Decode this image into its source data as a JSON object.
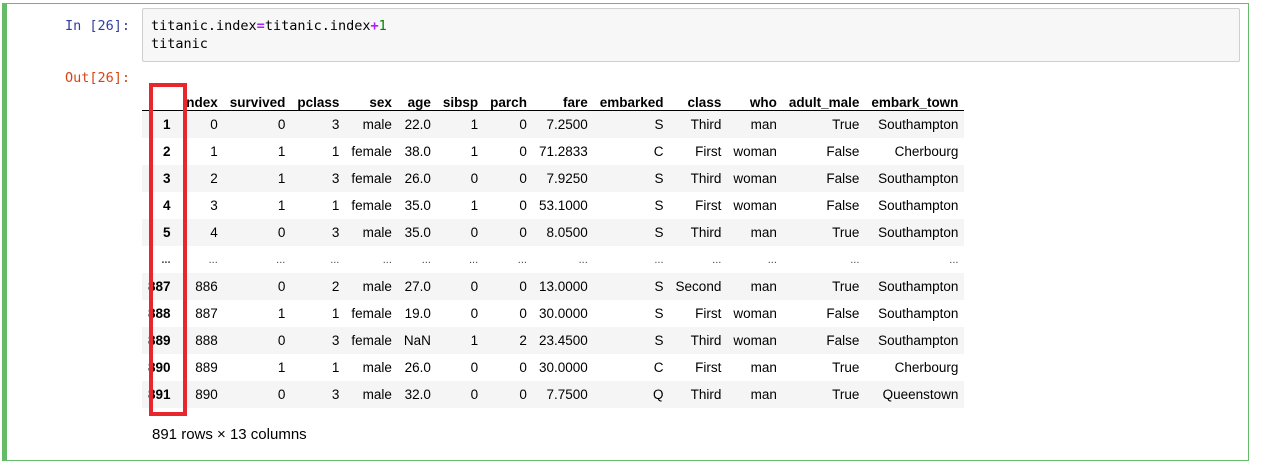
{
  "input": {
    "prompt": "In [26]:",
    "line1_a": "titanic.index",
    "line1_op1": "=",
    "line1_b": "titanic.index",
    "line1_op2": "+",
    "line1_num": "1",
    "line2": "titanic"
  },
  "output": {
    "prompt": "Out[26]:",
    "columns": [
      "",
      "index",
      "survived",
      "pclass",
      "sex",
      "age",
      "sibsp",
      "parch",
      "fare",
      "embarked",
      "class",
      "who",
      "adult_male",
      "embark_town"
    ],
    "rows": [
      [
        "1",
        "0",
        "0",
        "3",
        "male",
        "22.0",
        "1",
        "0",
        "7.2500",
        "S",
        "Third",
        "man",
        "True",
        "Southampton"
      ],
      [
        "2",
        "1",
        "1",
        "1",
        "female",
        "38.0",
        "1",
        "0",
        "71.2833",
        "C",
        "First",
        "woman",
        "False",
        "Cherbourg"
      ],
      [
        "3",
        "2",
        "1",
        "3",
        "female",
        "26.0",
        "0",
        "0",
        "7.9250",
        "S",
        "Third",
        "woman",
        "False",
        "Southampton"
      ],
      [
        "4",
        "3",
        "1",
        "1",
        "female",
        "35.0",
        "1",
        "0",
        "53.1000",
        "S",
        "First",
        "woman",
        "False",
        "Southampton"
      ],
      [
        "5",
        "4",
        "0",
        "3",
        "male",
        "35.0",
        "0",
        "0",
        "8.0500",
        "S",
        "Third",
        "man",
        "True",
        "Southampton"
      ],
      [
        "...",
        "...",
        "...",
        "...",
        "...",
        "...",
        "...",
        "...",
        "...",
        "...",
        "...",
        "...",
        "...",
        "..."
      ],
      [
        "887",
        "886",
        "0",
        "2",
        "male",
        "27.0",
        "0",
        "0",
        "13.0000",
        "S",
        "Second",
        "man",
        "True",
        "Southampton"
      ],
      [
        "888",
        "887",
        "1",
        "1",
        "female",
        "19.0",
        "0",
        "0",
        "30.0000",
        "S",
        "First",
        "woman",
        "False",
        "Southampton"
      ],
      [
        "889",
        "888",
        "0",
        "3",
        "female",
        "NaN",
        "1",
        "2",
        "23.4500",
        "S",
        "Third",
        "woman",
        "False",
        "Southampton"
      ],
      [
        "890",
        "889",
        "1",
        "1",
        "male",
        "26.0",
        "0",
        "0",
        "30.0000",
        "C",
        "First",
        "man",
        "True",
        "Cherbourg"
      ],
      [
        "891",
        "890",
        "0",
        "3",
        "male",
        "32.0",
        "0",
        "0",
        "7.7500",
        "Q",
        "Third",
        "man",
        "True",
        "Queenstown"
      ]
    ],
    "shape_text": "891 rows × 13 columns"
  },
  "colors": {
    "cell_border": "#66bb6a",
    "in_prompt": "#303f9f",
    "out_prompt": "#d84315",
    "highlight": "#e8262d"
  }
}
